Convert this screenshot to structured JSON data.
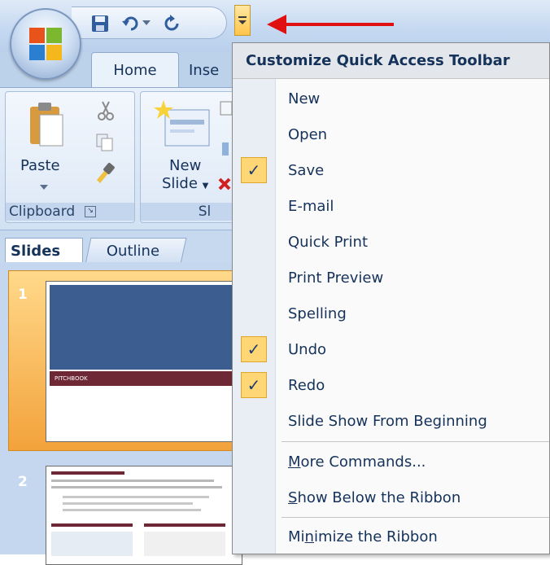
{
  "ribbon": {
    "tabs": {
      "home": "Home",
      "insert": "Inse"
    },
    "clipboard_group": {
      "label": "Clipboard",
      "paste": "Paste"
    },
    "slides_group": {
      "label": "Sl",
      "new_slide_line1": "New",
      "new_slide_line2": "Slide"
    }
  },
  "slides_pane": {
    "tabs": {
      "slides": "Slides",
      "outline": "Outline"
    },
    "slide_numbers": [
      "1",
      "2"
    ],
    "slide1_caption": "PITCHBOOK"
  },
  "menu": {
    "title": "Customize Quick Access Toolbar",
    "items": [
      {
        "label": "New",
        "checked": false
      },
      {
        "label": "Open",
        "checked": false
      },
      {
        "label": "Save",
        "checked": true
      },
      {
        "label": "E-mail",
        "checked": false
      },
      {
        "label": "Quick Print",
        "checked": false
      },
      {
        "label": "Print Preview",
        "checked": false
      },
      {
        "label": "Spelling",
        "checked": false
      },
      {
        "label": "Undo",
        "checked": true
      },
      {
        "label": "Redo",
        "checked": true
      },
      {
        "label": "Slide Show From Beginning",
        "checked": false
      }
    ],
    "more_commands": {
      "mnemonic": "M",
      "rest": "ore Commands..."
    },
    "show_below": {
      "mnemonic": "S",
      "rest": "how Below the Ribbon"
    },
    "minimize": {
      "pre": "Mi",
      "mnemonic": "n",
      "rest": "imize the Ribbon"
    },
    "check_glyph": "✓"
  },
  "colors": {
    "arrow": "#e01010",
    "check_bg": "#ffd675",
    "accent": "#15325a"
  }
}
